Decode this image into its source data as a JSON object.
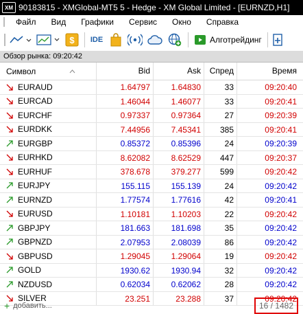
{
  "window": {
    "logo": "XM",
    "title": "90183815 - XMGlobal-MT5 5 - Hedge - XM Global Limited - [EURNZD,H1]"
  },
  "menu": [
    "Файл",
    "Вид",
    "Графики",
    "Сервис",
    "Окно",
    "Справка"
  ],
  "toolbar": {
    "ide_label": "IDE",
    "algo_label": "Алготрейдинг"
  },
  "panel": {
    "title": "Обзор рынка: 09:20:42"
  },
  "columns": {
    "symbol": "Символ",
    "bid": "Bid",
    "ask": "Ask",
    "spread": "Спред",
    "time": "Время"
  },
  "rows": [
    {
      "symbol": "EURAUD",
      "bid": "1.64797",
      "ask": "1.64830",
      "spread": "33",
      "time": "09:20:40",
      "dir": "down"
    },
    {
      "symbol": "EURCAD",
      "bid": "1.46044",
      "ask": "1.46077",
      "spread": "33",
      "time": "09:20:41",
      "dir": "down"
    },
    {
      "symbol": "EURCHF",
      "bid": "0.97337",
      "ask": "0.97364",
      "spread": "27",
      "time": "09:20:39",
      "dir": "down"
    },
    {
      "symbol": "EURDKK",
      "bid": "7.44956",
      "ask": "7.45341",
      "spread": "385",
      "time": "09:20:41",
      "dir": "down"
    },
    {
      "symbol": "EURGBP",
      "bid": "0.85372",
      "ask": "0.85396",
      "spread": "24",
      "time": "09:20:39",
      "dir": "up"
    },
    {
      "symbol": "EURHKD",
      "bid": "8.62082",
      "ask": "8.62529",
      "spread": "447",
      "time": "09:20:37",
      "dir": "down"
    },
    {
      "symbol": "EURHUF",
      "bid": "378.678",
      "ask": "379.277",
      "spread": "599",
      "time": "09:20:42",
      "dir": "down"
    },
    {
      "symbol": "EURJPY",
      "bid": "155.115",
      "ask": "155.139",
      "spread": "24",
      "time": "09:20:42",
      "dir": "up"
    },
    {
      "symbol": "EURNZD",
      "bid": "1.77574",
      "ask": "1.77616",
      "spread": "42",
      "time": "09:20:41",
      "dir": "up"
    },
    {
      "symbol": "EURUSD",
      "bid": "1.10181",
      "ask": "1.10203",
      "spread": "22",
      "time": "09:20:42",
      "dir": "down"
    },
    {
      "symbol": "GBPJPY",
      "bid": "181.663",
      "ask": "181.698",
      "spread": "35",
      "time": "09:20:42",
      "dir": "up"
    },
    {
      "symbol": "GBPNZD",
      "bid": "2.07953",
      "ask": "2.08039",
      "spread": "86",
      "time": "09:20:42",
      "dir": "up"
    },
    {
      "symbol": "GBPUSD",
      "bid": "1.29045",
      "ask": "1.29064",
      "spread": "19",
      "time": "09:20:42",
      "dir": "down"
    },
    {
      "symbol": "GOLD",
      "bid": "1930.62",
      "ask": "1930.94",
      "spread": "32",
      "time": "09:20:42",
      "dir": "up"
    },
    {
      "symbol": "NZDUSD",
      "bid": "0.62034",
      "ask": "0.62062",
      "spread": "28",
      "time": "09:20:42",
      "dir": "up"
    },
    {
      "symbol": "SILVER",
      "bid": "23.251",
      "ask": "23.288",
      "spread": "37",
      "time": "09:20:42",
      "dir": "down"
    }
  ],
  "footer": {
    "add_label": "добавить...",
    "count": "16 / 1482"
  },
  "colors": {
    "up": "#0000cc",
    "down": "#d10000",
    "highlight": "#e00000"
  }
}
